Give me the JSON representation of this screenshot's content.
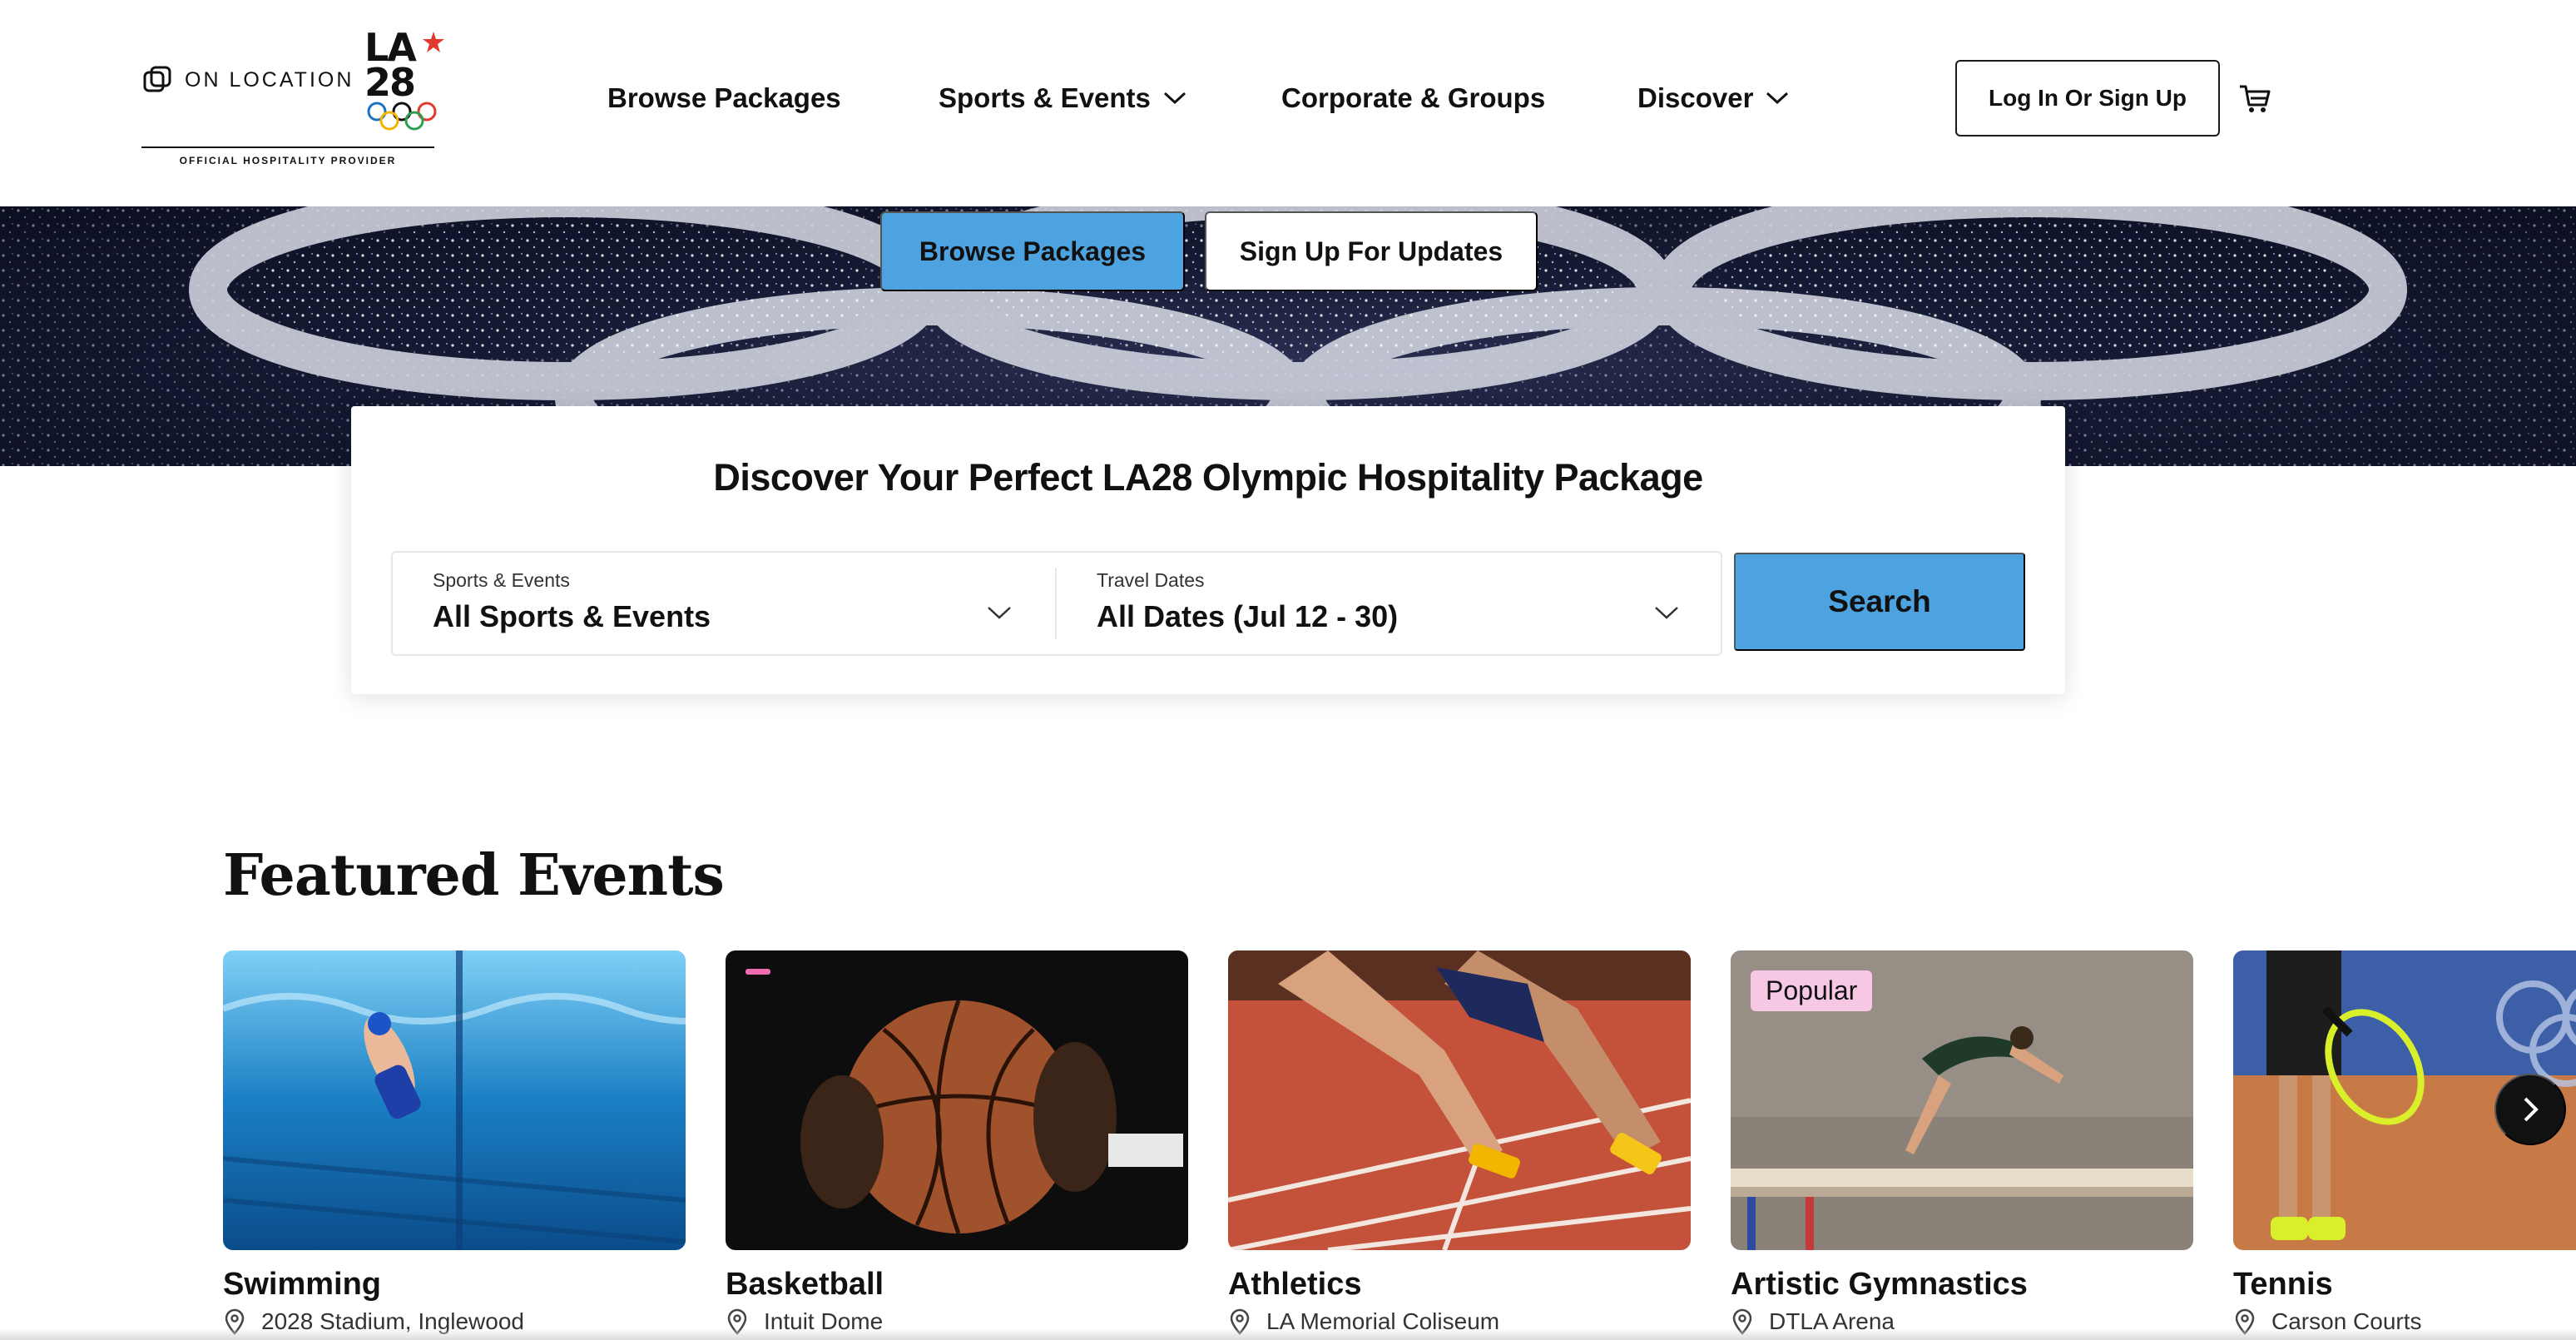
{
  "brand": {
    "on_location": "ON LOCATION",
    "la28": "LA 28",
    "tagline": "OFFICIAL HOSPITALITY PROVIDER"
  },
  "nav": {
    "browse": "Browse Packages",
    "sports": "Sports & Events",
    "corporate": "Corporate & Groups",
    "discover": "Discover",
    "login": "Log In Or Sign Up"
  },
  "hero": {
    "browse_button": "Browse Packages",
    "signup_button": "Sign Up For Updates"
  },
  "search": {
    "title": "Discover Your Perfect LA28 Olympic Hospitality Package",
    "sports_label": "Sports & Events",
    "sports_value": "All Sports & Events",
    "dates_label": "Travel Dates",
    "dates_value": "All Dates (Jul 12 - 30)",
    "button": "Search"
  },
  "featured": {
    "title": "Featured Events",
    "events": [
      {
        "name": "Swimming",
        "location": "2028 Stadium, Inglewood"
      },
      {
        "name": "Basketball",
        "location": "Intuit Dome"
      },
      {
        "name": "Athletics",
        "location": "LA Memorial Coliseum"
      },
      {
        "name": "Artistic Gymnastics",
        "location": "DTLA Arena",
        "badge": "Popular"
      },
      {
        "name": "Tennis",
        "location": "Carson Courts"
      }
    ]
  },
  "colors": {
    "accent_blue": "#4da3e0",
    "badge_pink": "#f6c8e4"
  }
}
